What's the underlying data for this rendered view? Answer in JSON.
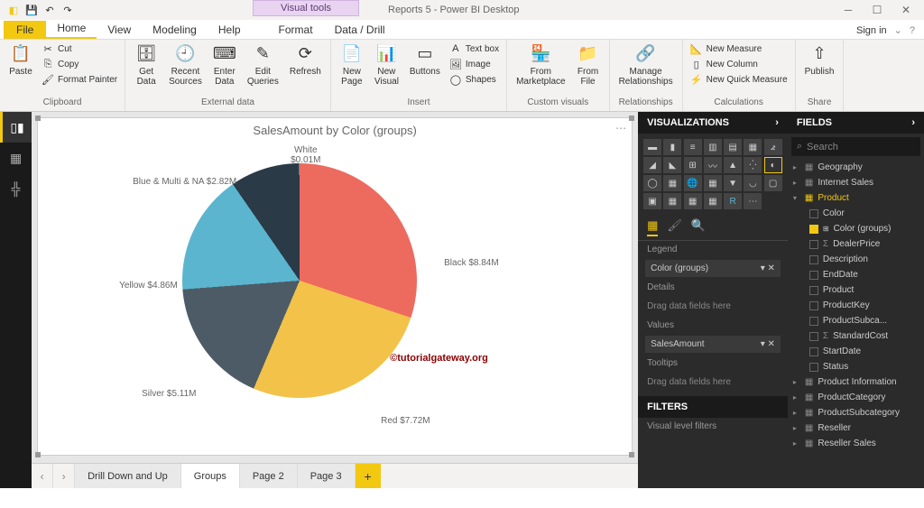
{
  "title": "Reports 5 - Power BI Desktop",
  "visualTools": "Visual tools",
  "signin": "Sign in",
  "fileTab": "File",
  "menuTabs": [
    "Home",
    "View",
    "Modeling",
    "Help",
    "Format",
    "Data / Drill"
  ],
  "ribbon": {
    "clipboard": {
      "label": "Clipboard",
      "paste": "Paste",
      "cut": "Cut",
      "copy": "Copy",
      "fmt": "Format Painter"
    },
    "external": {
      "label": "External data",
      "get": "Get\nData",
      "recent": "Recent\nSources",
      "enter": "Enter\nData",
      "edit": "Edit\nQueries",
      "refresh": "Refresh"
    },
    "insert": {
      "label": "Insert",
      "newpage": "New\nPage",
      "newvis": "New\nVisual",
      "buttons": "Buttons",
      "textbox": "Text box",
      "image": "Image",
      "shapes": "Shapes"
    },
    "custom": {
      "label": "Custom visuals",
      "market": "From\nMarketplace",
      "file": "From\nFile"
    },
    "rel": {
      "label": "Relationships",
      "manage": "Manage\nRelationships"
    },
    "calc": {
      "label": "Calculations",
      "measure": "New Measure",
      "column": "New Column",
      "quick": "New Quick Measure"
    },
    "share": {
      "label": "Share",
      "publish": "Publish"
    }
  },
  "chart_data": {
    "type": "pie",
    "title": "SalesAmount by Color (groups)",
    "series": [
      {
        "name": "Black",
        "value": 8.84,
        "label": "Black $8.84M",
        "color": "#ed6a5e"
      },
      {
        "name": "Red",
        "value": 7.72,
        "label": "Red $7.72M",
        "color": "#f2c249"
      },
      {
        "name": "Silver",
        "value": 5.11,
        "label": "Silver $5.11M",
        "color": "#4d5b66"
      },
      {
        "name": "Yellow",
        "value": 4.86,
        "label": "Yellow $4.86M",
        "color": "#5bb5cf"
      },
      {
        "name": "Blue & Multi & NA",
        "value": 2.82,
        "label": "Blue & Multi & NA $2.82M",
        "color": "#2a3a47"
      },
      {
        "name": "White",
        "value": 0.01,
        "label": "White\n$0.01M",
        "color": "#8ad4b8"
      }
    ]
  },
  "watermark": "©tutorialgateway.org",
  "tabs": {
    "items": [
      "Drill Down and Up",
      "Groups",
      "Page 2",
      "Page 3"
    ]
  },
  "viz": {
    "header": "VISUALIZATIONS",
    "legend": "Legend",
    "legendField": "Color (groups)",
    "details": "Details",
    "detailsPh": "Drag data fields here",
    "values": "Values",
    "valuesField": "SalesAmount",
    "tooltips": "Tooltips",
    "tooltipsPh": "Drag data fields here",
    "filters": "FILTERS",
    "visualFilters": "Visual level filters"
  },
  "fields": {
    "header": "FIELDS",
    "search": "Search",
    "tables": [
      "Geography",
      "Internet Sales"
    ],
    "product": "Product",
    "productCols": [
      "Color",
      "Color (groups)",
      "DealerPrice",
      "Description",
      "EndDate",
      "Product",
      "ProductKey",
      "ProductSubca...",
      "StandardCost",
      "StartDate",
      "Status"
    ],
    "more": [
      "Product Information",
      "ProductCategory",
      "ProductSubcategory",
      "Reseller",
      "Reseller Sales"
    ]
  }
}
